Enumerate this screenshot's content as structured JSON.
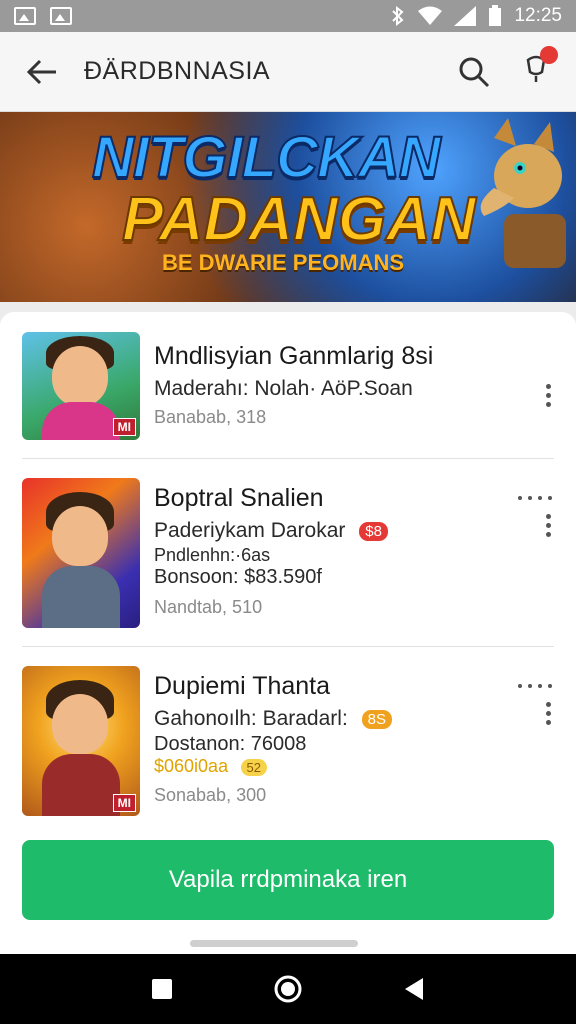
{
  "status_bar": {
    "time": "12:25"
  },
  "app_bar": {
    "title": "ĐÄRDBNNASIA"
  },
  "banner": {
    "line1": "NITGILCKAN",
    "line2": "PADANGAN",
    "line3": "BE DWARIE PEOMANS"
  },
  "list": {
    "items": [
      {
        "title": "Mndlisyian Ganmlarig 8si",
        "subtitle": "Maderahı: Nolah· AöP.Soan",
        "meta": "Banabab, 318"
      },
      {
        "title": "Boptral Snalien",
        "subtitle": "Paderiykam Darokar",
        "badge": "$8",
        "line3": "Pndlenhn:·6as",
        "line4": "Bonsoon: $83.590f",
        "meta": "Nandtab, 510"
      },
      {
        "title": "Dupiemi Thanta",
        "subtitle": "Gahonoılh: Baradarl:",
        "badge": "8S",
        "line3": "Dostanon: 76008",
        "price": "$060i0aa",
        "price_badge": "52",
        "meta": "Sonabab, 300"
      }
    ]
  },
  "cta": {
    "label": "Vapila rrdpminaka iren"
  },
  "colors": {
    "accent": "#1dbb6a",
    "notification": "#e53935",
    "badge_red": "#e53935",
    "badge_orange": "#f0a21e"
  }
}
